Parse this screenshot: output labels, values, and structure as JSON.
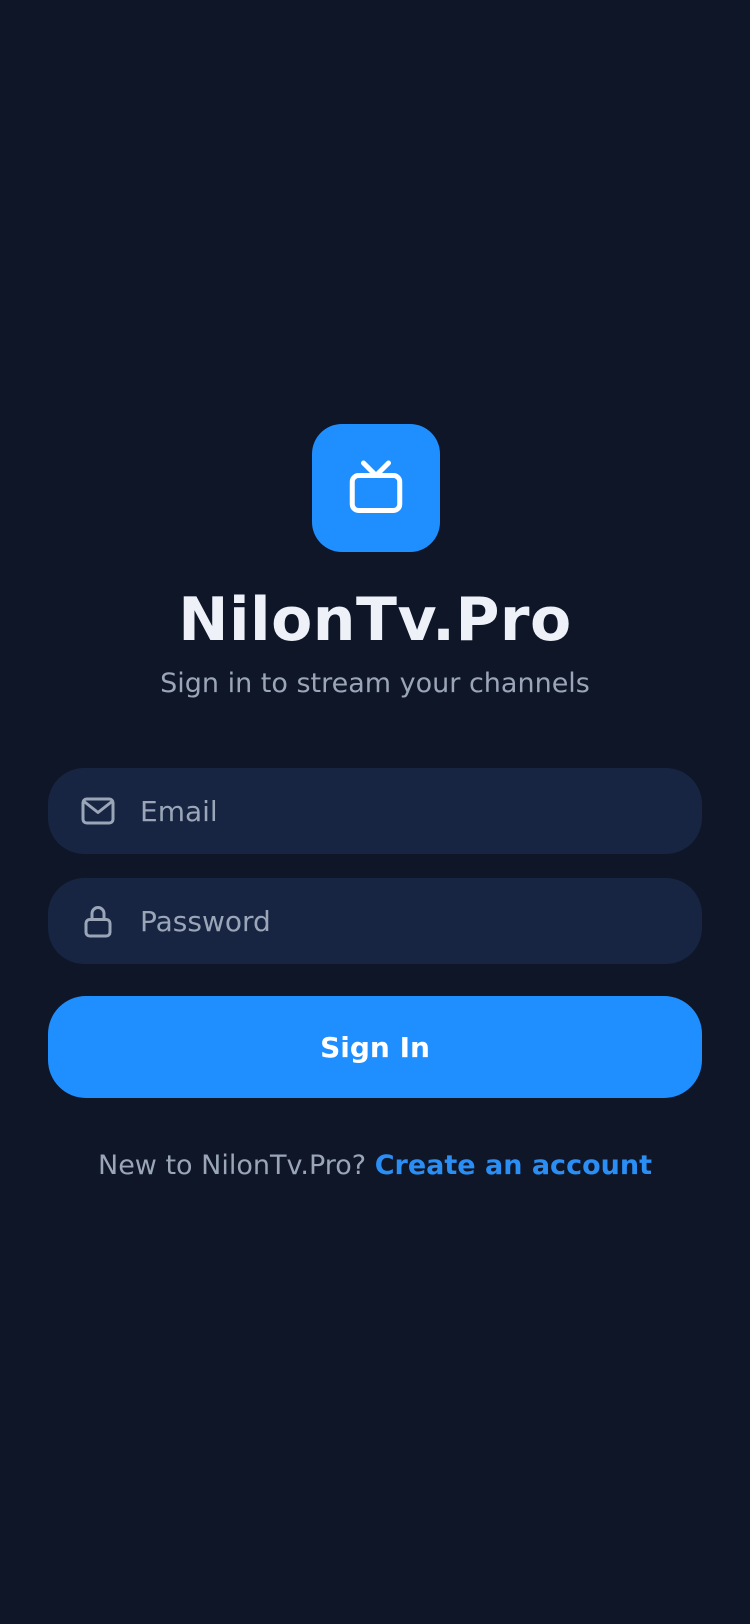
{
  "app": {
    "name": "NilonTv.Pro",
    "subtitle": "Sign in to stream your channels",
    "logo_icon": "tv-icon"
  },
  "form": {
    "email": {
      "icon": "mail-icon",
      "value": "",
      "placeholder": "Email"
    },
    "password": {
      "icon": "lock-icon",
      "value": "",
      "placeholder": "Password"
    },
    "submit_label": "Sign In"
  },
  "signup": {
    "prompt": "New to NilonTv.Pro?",
    "link_label": "Create an account"
  },
  "colors": {
    "background": "#0e1628",
    "accent": "#1f8fff",
    "field_background": "#172542",
    "title_text": "#eef2f8",
    "muted_text": "#9aa6b8",
    "link": "#2b8ef5"
  }
}
